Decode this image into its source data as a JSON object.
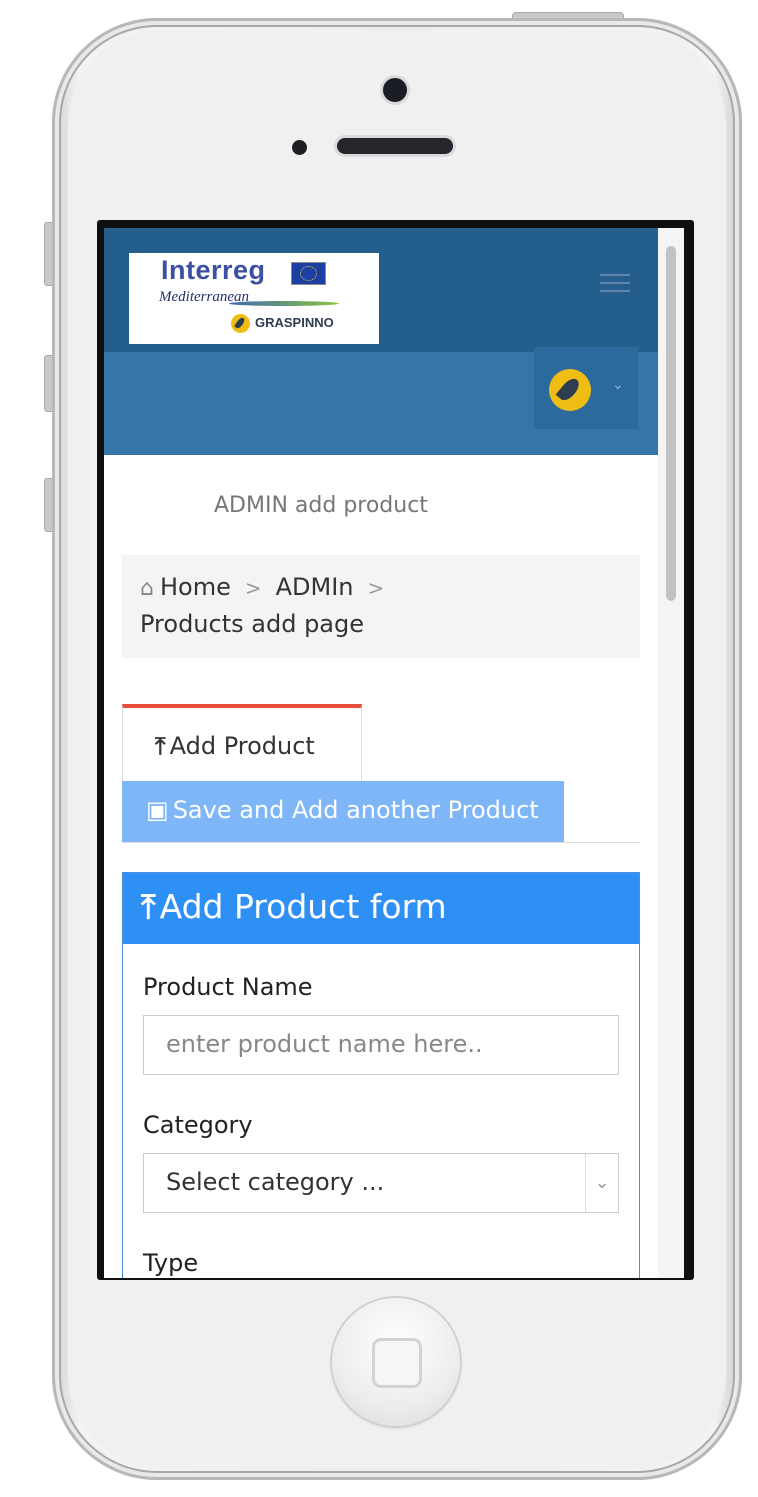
{
  "logo": {
    "interreg": "Interreg",
    "mediterranean": "Mediterranean",
    "graspinno": "GRASPINNO"
  },
  "header": {
    "menu_icon": "hamburger-icon",
    "user_avatar_icon": "leaf-avatar-icon",
    "user_caret_icon": "chevron-down-icon"
  },
  "page": {
    "title": "ADMIN add product"
  },
  "breadcrumb": {
    "home": "Home",
    "admin": "ADMIn",
    "current": "Products add page",
    "separator": ">"
  },
  "tabs": {
    "add_product": "Add Product",
    "save_and_add": "Save and Add another Product"
  },
  "form": {
    "title": "Add Product form",
    "product_name_label": "Product Name",
    "product_name_placeholder": "enter product name here..",
    "category_label": "Category",
    "category_selected": "Select category ...",
    "type_label": "Type"
  },
  "colors": {
    "header_dark": "#245e8c",
    "header_light": "#3576aa",
    "tab_active_border": "#e74c3c",
    "save_tab": "#7fb6f7",
    "panel_header": "#2e8ff5"
  }
}
